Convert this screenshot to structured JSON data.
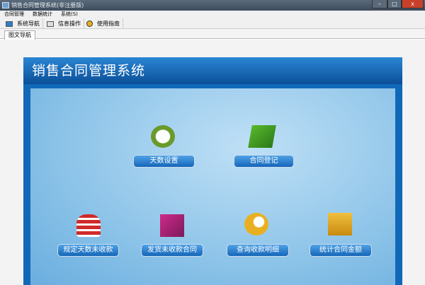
{
  "window": {
    "title": "销售合同管理系统(非注册版)",
    "minimize": "–",
    "maximize": "□",
    "close": "x"
  },
  "menu": [
    "合同管理",
    "数据统计",
    "系统(S)"
  ],
  "toolbar": [
    "系统导航",
    "信息操作",
    "使用指南"
  ],
  "tabs": [
    "图文导航"
  ],
  "panel": {
    "title": "销售合同管理系统",
    "buttons": [
      "天数设置",
      "合同登记",
      "规定天数未收款",
      "发货未收款合同",
      "查询收款明细",
      "统计合同金额"
    ]
  }
}
